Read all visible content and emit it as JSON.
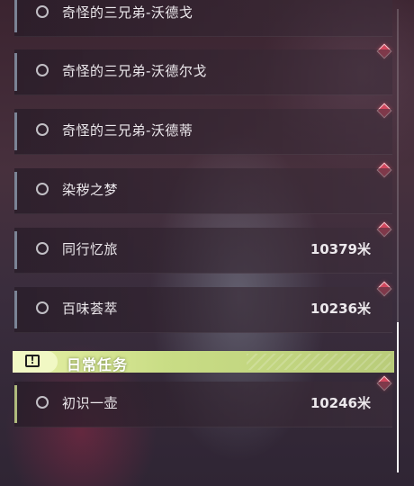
{
  "quests": [
    {
      "title": "奇怪的三兄弟-沃德戈",
      "distance": ""
    },
    {
      "title": "奇怪的三兄弟-沃德尔戈",
      "distance": ""
    },
    {
      "title": "奇怪的三兄弟-沃德蒂",
      "distance": ""
    },
    {
      "title": "染秽之梦",
      "distance": ""
    },
    {
      "title": "同行忆旅",
      "distance": "10379米"
    },
    {
      "title": "百味荟萃",
      "distance": "10236米"
    }
  ],
  "section": {
    "title": "日常任务",
    "icon": "exclamation-icon"
  },
  "daily_quests": [
    {
      "title": "初识一壶",
      "distance": "10246米"
    }
  ],
  "colors": {
    "marker": "#d2485e",
    "section_accent": "#c9dd85"
  }
}
